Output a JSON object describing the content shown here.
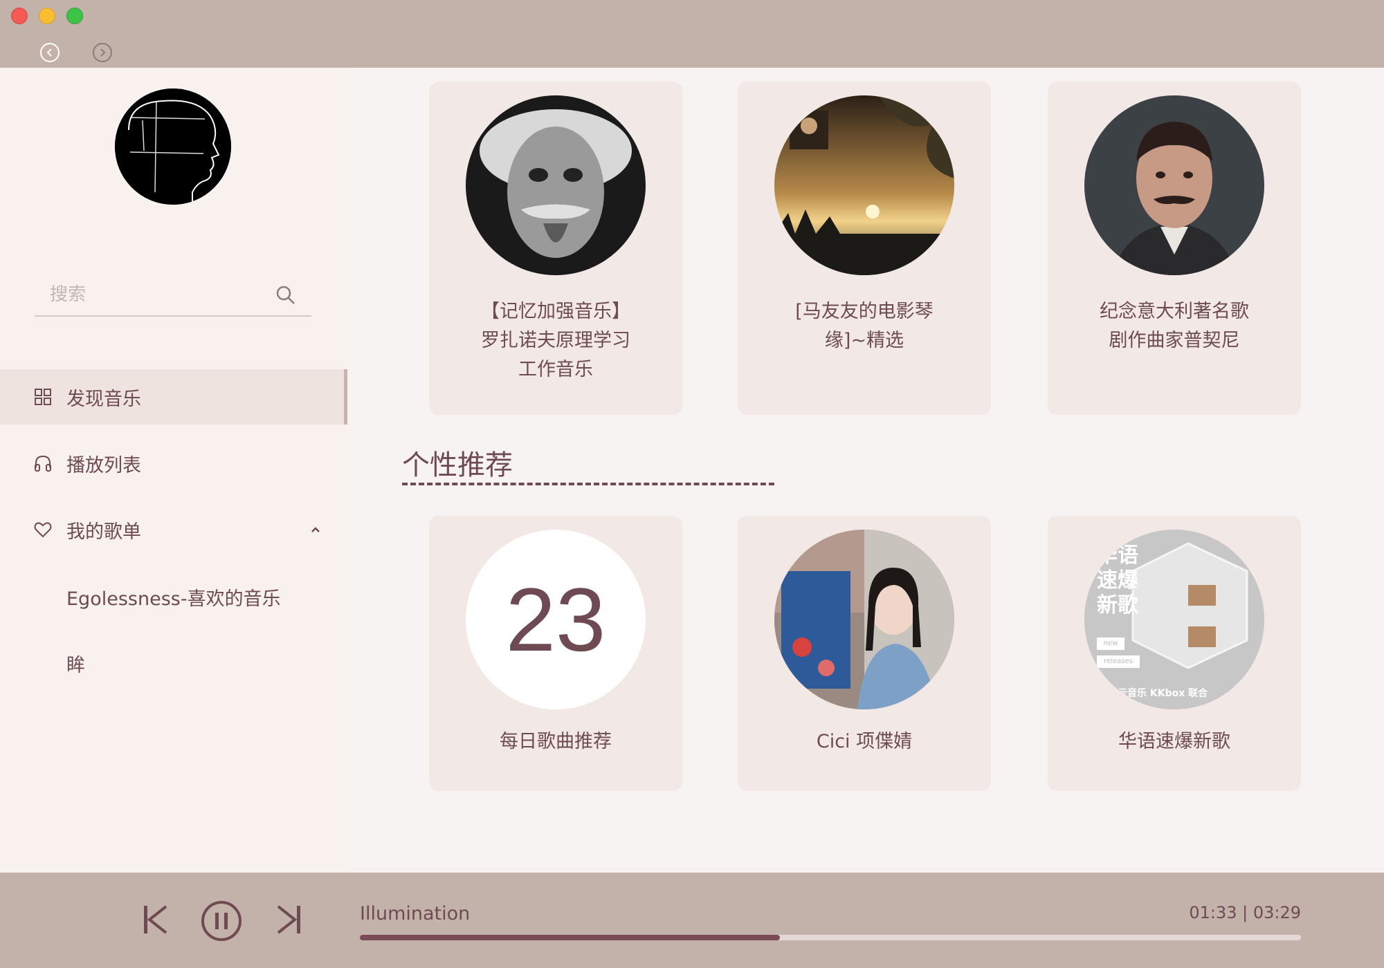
{
  "window": {
    "colors": {
      "accent": "#6e4a52",
      "frame": "#c3b2aa",
      "sidebar": "#f8f1ee",
      "main": "#f6f3f2",
      "card": "#f2e8e6"
    }
  },
  "toolbar": {
    "back_icon": "chevron-left-circle-icon",
    "forward_icon": "chevron-right-circle-icon"
  },
  "sidebar": {
    "search": {
      "placeholder": "搜索",
      "value": "",
      "icon": "search-icon"
    },
    "nav": [
      {
        "label": "发现音乐",
        "icon": "grid-icon",
        "active": true
      },
      {
        "label": "播放列表",
        "icon": "headphones-icon",
        "active": false
      },
      {
        "label": "我的歌单",
        "icon": "heart-icon",
        "active": false,
        "expanded": true
      }
    ],
    "playlists": [
      {
        "label": "Egolessness-喜欢的音乐"
      },
      {
        "label": "眸"
      }
    ]
  },
  "main": {
    "top_cards": [
      {
        "title_lines": [
          "【记忆加强音乐】",
          "罗扎诺夫原理学习",
          "工作音乐"
        ]
      },
      {
        "title_lines": [
          "[马友友的电影琴",
          "缘]~精选"
        ]
      },
      {
        "title_lines": [
          "纪念意大利著名歌",
          "剧作曲家普契尼"
        ]
      }
    ],
    "section_title": "个性推荐",
    "recommend_cards": [
      {
        "title": "每日歌曲推荐",
        "day": "23"
      },
      {
        "title": "Cici 项偞婧"
      },
      {
        "title": "华语速爆新歌",
        "cover_text": [
          "华语",
          "速爆",
          "新歌"
        ],
        "cover_tags": [
          "new",
          "releases"
        ],
        "cover_footer": "网易云音乐 KKbox 联合"
      }
    ]
  },
  "player": {
    "track": "Illumination",
    "current_time": "01:33",
    "total_time": "03:29",
    "time_display": "01:33 | 03:29",
    "progress": 0.446,
    "controls": [
      "skip-previous-icon",
      "pause-icon",
      "skip-next-icon"
    ]
  }
}
